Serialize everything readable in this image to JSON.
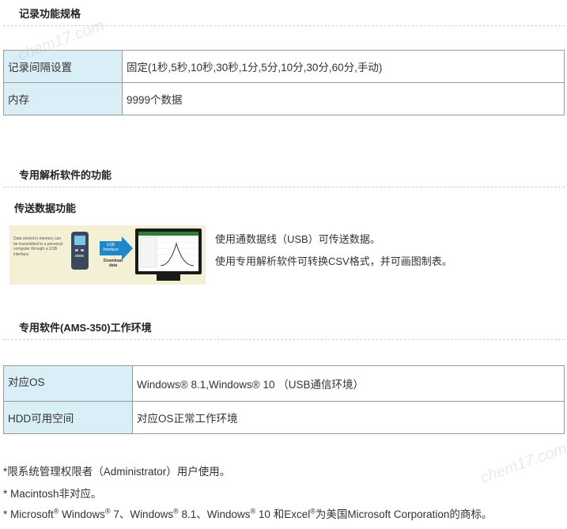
{
  "section1": {
    "title": "记录功能规格",
    "rows": [
      {
        "key": "记录间隔设置",
        "value": "固定(1秒,5秒,10秒,30秒,1分,5分,10分,30分,60分,手动)"
      },
      {
        "key": "内存",
        "value": "9999个数据"
      }
    ]
  },
  "section2": {
    "title": "专用解析软件的功能",
    "subtitle": "传送数据功能",
    "graphic": {
      "caption": "Data stored in memory can be transmitted to a personal computer through a USB interface.",
      "arrow_label": "USB Interface",
      "download_label": "Download data"
    },
    "lines": [
      "使用通数据线（USB）可传送数据。",
      "使用专用解析软件可转换CSV格式，并可画图制表。"
    ]
  },
  "section3": {
    "title": "专用软件(AMS-350)工作环境",
    "rows": [
      {
        "key": "对应OS",
        "value": "Windows® 8.1,Windows® 10 （USB通信环境）"
      },
      {
        "key": "HDD可用空间",
        "value": "对应OS正常工作环境"
      }
    ]
  },
  "notes": {
    "n1": "*限系统管理权限者（Administrator）用户使用。",
    "n2": "* Macintosh非对应。",
    "n3": {
      "p1": "* Microsoft",
      "p2": " Windows",
      "p3": " 7、Windows",
      "p4": " 8.1、Windows",
      "p5": " 10 和Excel",
      "p6": "为美国Microsoft Corporation的商标。",
      "reg": "®"
    }
  },
  "watermark": "chem17.com",
  "colors": {
    "key_bg": "#daeef7",
    "border": "#9a9a9a",
    "arrow": "#1e88c8",
    "bg": "#ffffff"
  }
}
